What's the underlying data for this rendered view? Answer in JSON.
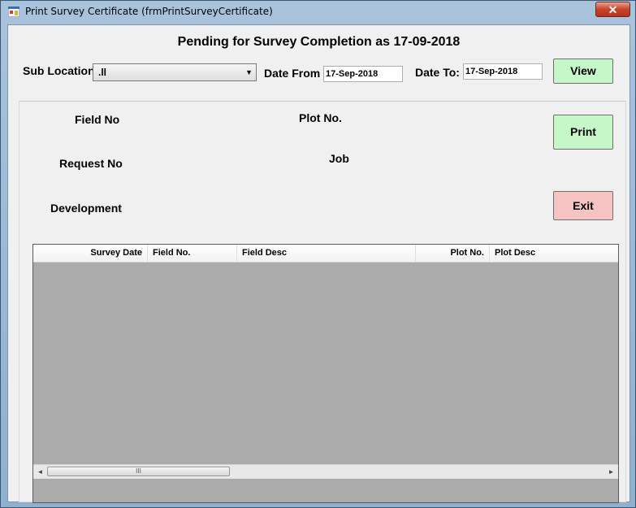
{
  "window": {
    "title": "Print Survey Certificate (frmPrintSurveyCertificate)",
    "close_label": "✕"
  },
  "heading": "Pending for Survey Completion  as  17-09-2018",
  "filters": {
    "sub_location_label": "Sub Location",
    "sub_location_value": ".ll",
    "date_from_label": "Date From",
    "date_from_value": "17-Sep-2018",
    "date_to_label": "Date To:",
    "date_to_value": "17-Sep-2018",
    "view_label": "View"
  },
  "fields": {
    "field_no_label": "Field No",
    "plot_no_label": "Plot No.",
    "request_no_label": "Request No",
    "job_label": "Job",
    "development_label": "Development"
  },
  "buttons": {
    "print_label": "Print",
    "exit_label": "Exit"
  },
  "grid": {
    "columns": [
      "Survey Date",
      "Field No.",
      "Field Desc",
      "Plot No.",
      "Plot Desc"
    ],
    "rows": []
  },
  "scrollbar": {
    "thumb_grip": "III",
    "left_arrow": "◄",
    "right_arrow": "►"
  },
  "colors": {
    "green_button": "#c6f7c8",
    "red_button": "#f7c4c4",
    "grid_background": "#ababab"
  }
}
